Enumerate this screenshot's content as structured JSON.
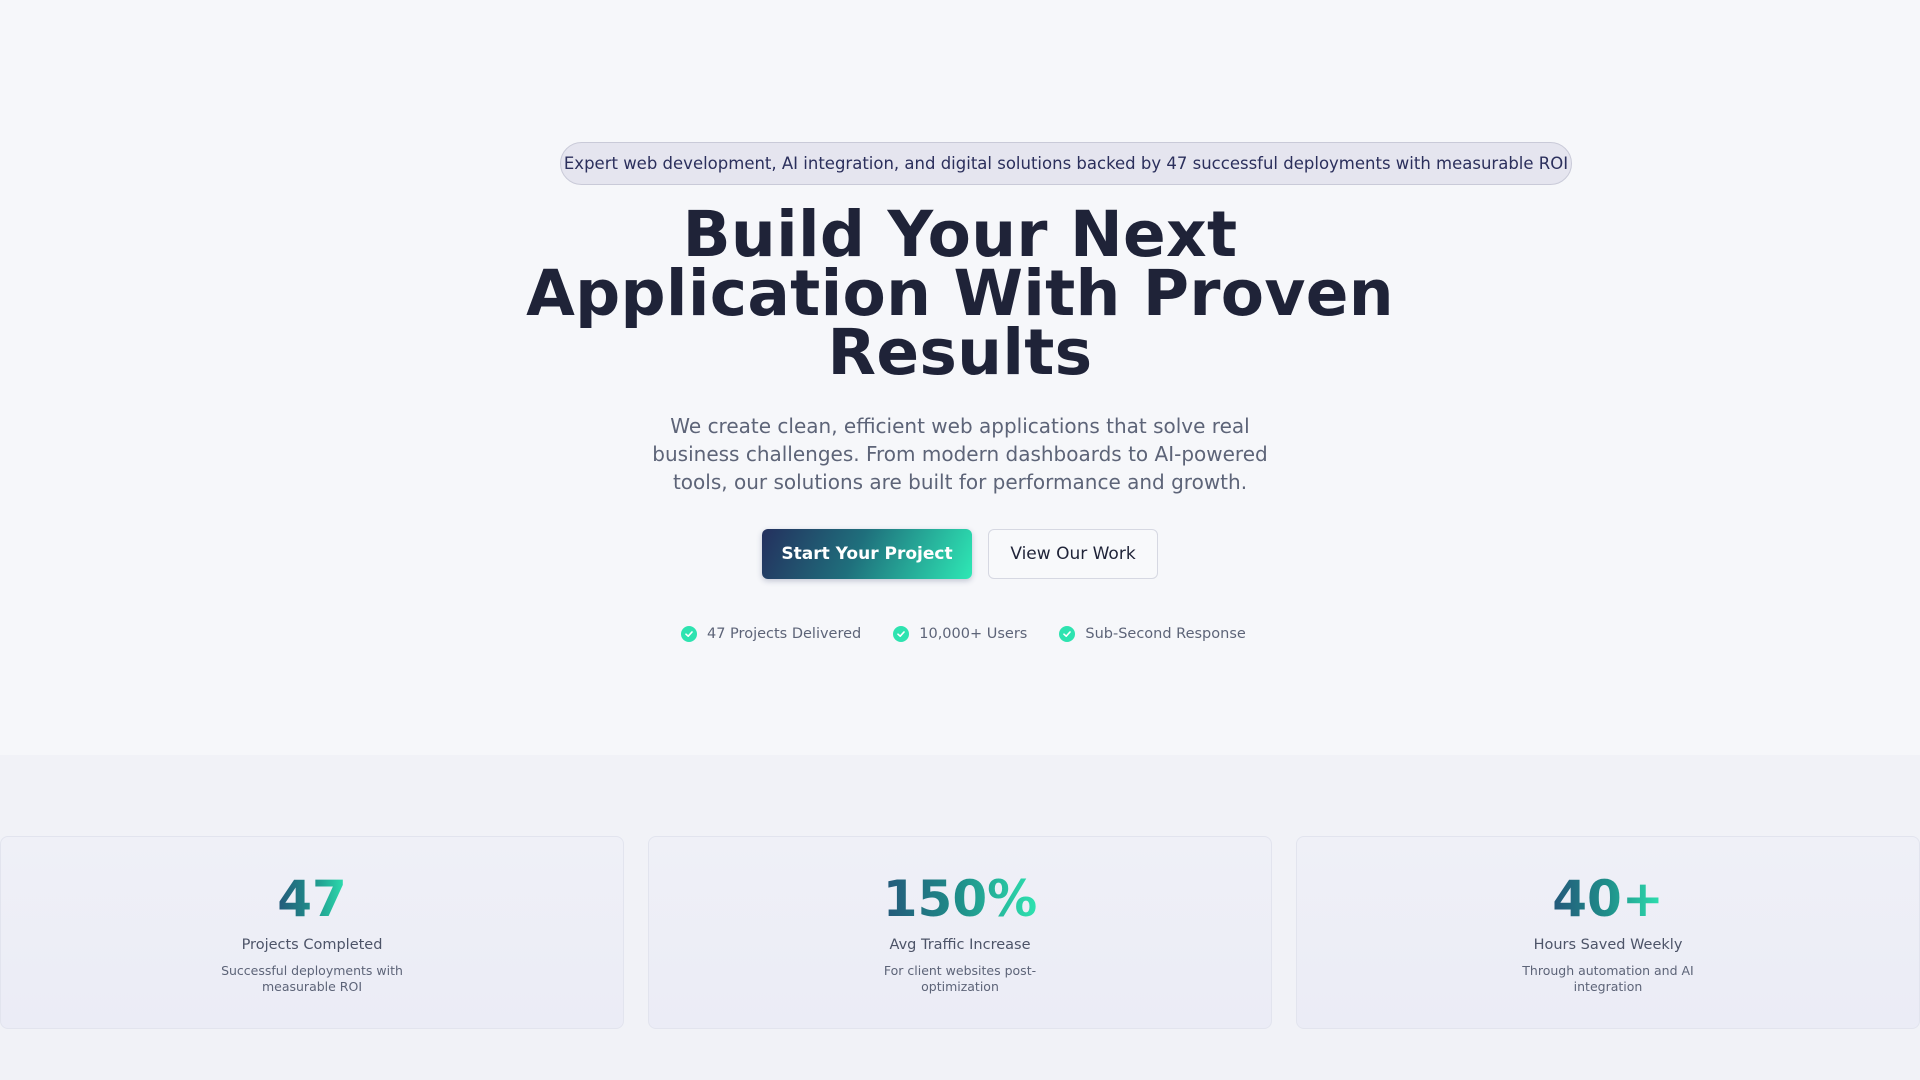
{
  "hero": {
    "tagline": "Expert web development, AI integration, and digital solutions backed by 47 successful deployments with measurable ROI",
    "headline_line1": "Build Your Next",
    "headline_line2": "Application With Proven",
    "headline_line3": "Results",
    "subtext": "We create clean, efficient web applications that solve real business challenges. From modern dashboards to AI-powered tools, our solutions are built for performance and growth.",
    "primary_cta": "Start Your Project",
    "secondary_cta": "View Our Work",
    "badges": [
      {
        "label": "47 Projects Delivered",
        "icon": "check-circle-icon"
      },
      {
        "label": "10,000+ Users",
        "icon": "check-circle-icon"
      },
      {
        "label": "Sub-Second Response",
        "icon": "check-circle-icon"
      }
    ]
  },
  "stats": [
    {
      "value": "47",
      "label": "Projects Completed",
      "description": "Successful deployments with measurable ROI"
    },
    {
      "value": "150%",
      "label": "Avg Traffic Increase",
      "description": "For client websites post-optimization"
    },
    {
      "value": "40+",
      "label": "Hours Saved Weekly",
      "description": "Through automation and AI integration"
    }
  ],
  "colors": {
    "accent": "#2ee3b0",
    "brand_dark": "#24305e",
    "text_dark": "#1f2338",
    "text_muted": "#5d6478"
  }
}
